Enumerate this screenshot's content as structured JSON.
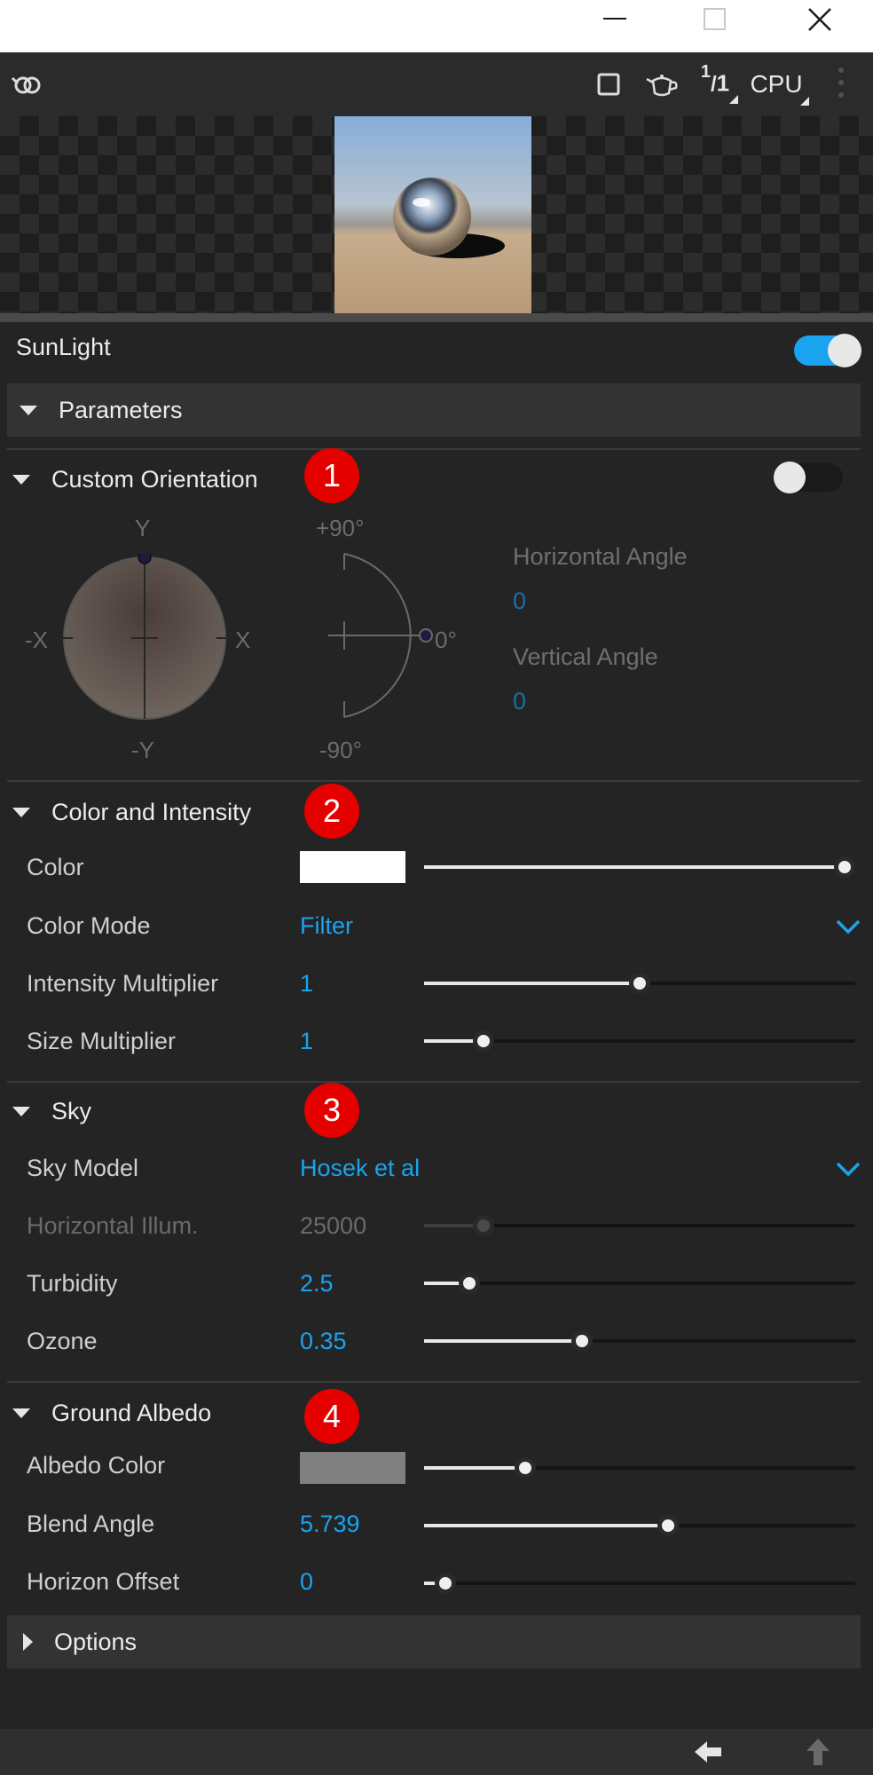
{
  "toolbar": {
    "ratio_label": "1/1",
    "ratio_num": "1",
    "ratio_den": "1",
    "device_label": "CPU"
  },
  "node": {
    "title": "SunLight",
    "enabled": true
  },
  "parameters": {
    "label": "Parameters"
  },
  "custom_orientation": {
    "label": "Custom Orientation",
    "badge": "1",
    "enabled": false,
    "sphere_labels": {
      "top": "Y",
      "bottom": "-Y",
      "left": "-X",
      "right": "X"
    },
    "arc_labels": {
      "top": "+90°",
      "middle": "0°",
      "bottom": "-90°"
    },
    "horizontal_angle": {
      "label": "Horizontal Angle",
      "value": "0"
    },
    "vertical_angle": {
      "label": "Vertical Angle",
      "value": "0"
    }
  },
  "color_intensity": {
    "label": "Color and Intensity",
    "badge": "2",
    "color": {
      "label": "Color",
      "swatch": "#ffffff",
      "level": 1.0
    },
    "color_mode": {
      "label": "Color Mode",
      "value": "Filter"
    },
    "intensity_multiplier": {
      "label": "Intensity Multiplier",
      "value": "1",
      "level": 0.5
    },
    "size_multiplier": {
      "label": "Size Multiplier",
      "value": "1",
      "level": 0.12
    }
  },
  "sky": {
    "label": "Sky",
    "badge": "3",
    "sky_model": {
      "label": "Sky Model",
      "value": "Hosek et al"
    },
    "horizontal_illum": {
      "label": "Horizontal Illum.",
      "value": "25000",
      "level": 0.12,
      "disabled": true
    },
    "turbidity": {
      "label": "Turbidity",
      "value": "2.5",
      "level": 0.085
    },
    "ozone": {
      "label": "Ozone",
      "value": "0.35",
      "level": 0.36
    }
  },
  "ground_albedo": {
    "label": "Ground Albedo",
    "badge": "4",
    "albedo_color": {
      "label": "Albedo Color",
      "swatch": "#808080",
      "level": 0.22
    },
    "blend_angle": {
      "label": "Blend Angle",
      "value": "5.739",
      "level": 0.57
    },
    "horizon_offset": {
      "label": "Horizon Offset",
      "value": "0",
      "level": 0.025
    }
  },
  "options": {
    "label": "Options"
  },
  "colors": {
    "accent": "#1aa3ee",
    "badge": "#e50000",
    "background": "#242424"
  }
}
